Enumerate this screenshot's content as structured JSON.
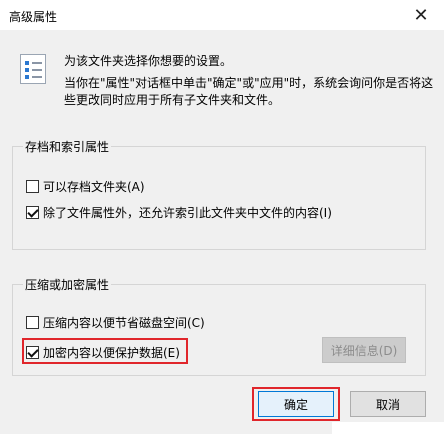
{
  "window": {
    "title": "高级属性",
    "close_icon": "close-icon"
  },
  "header": {
    "icon": "properties-list-icon",
    "line1": "为该文件夹选择你想要的设置。",
    "line2": "当你在\"属性\"对话框中单击\"确定\"或\"应用\"时，系统会询问你是否将这些更改同时应用于所有子文件夹和文件。"
  },
  "archive_group": {
    "title": "存档和索引属性",
    "options": [
      {
        "label": "可以存档文件夹(A)",
        "checked": false
      },
      {
        "label": "除了文件属性外，还允许索引此文件夹中文件的内容(I)",
        "checked": true
      }
    ]
  },
  "compress_group": {
    "title": "压缩或加密属性",
    "options": [
      {
        "label": "压缩内容以便节省磁盘空间(C)",
        "checked": false
      },
      {
        "label": "加密内容以便保护数据(E)",
        "checked": true
      }
    ],
    "details_button": "详细信息(D)"
  },
  "buttons": {
    "ok": "确定",
    "cancel": "取消"
  },
  "colors": {
    "highlight": "#e0262b",
    "dialog_bg": "#f0f0f0",
    "focus_border": "#0078d7"
  }
}
